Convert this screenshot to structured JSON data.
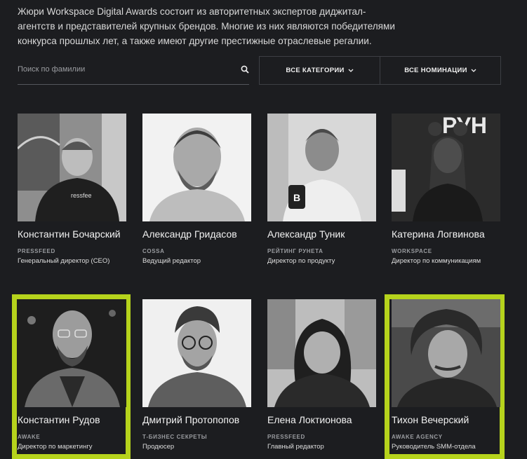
{
  "intro": "Жюри Workspace Digital Awards состоит из авторитетных экспертов диджитал-агентств и представителей крупных брендов. Многие из них являются победителями конкурса прошлых лет, а также имеют другие престижные отраслевые регалии.",
  "search": {
    "placeholder": "Поиск по фамилии",
    "icon": "search-icon"
  },
  "filters": {
    "categories_label": "Все категории",
    "nominations_label": "Все номинации",
    "icon": "chevron-down-icon"
  },
  "colors": {
    "background": "#1c1d20",
    "highlight": "#b6d31c"
  },
  "jury": [
    {
      "name": "Константин Бочарский",
      "company": "PRESSFEED",
      "role": "Генеральный директор (CEO)",
      "highlighted": false
    },
    {
      "name": "Александр Гридасов",
      "company": "COSSA",
      "role": "Ведущий редактор",
      "highlighted": false
    },
    {
      "name": "Александр Туник",
      "company": "РЕЙТИНГ РУНЕТА",
      "role": "Директор по продукту",
      "highlighted": false
    },
    {
      "name": "Катерина Логвинова",
      "company": "WORKSPACE",
      "role": "Директор по коммуникациям",
      "highlighted": false
    },
    {
      "name": "Константин Рудов",
      "company": "AWAKE",
      "role": "Директор по маркетингу",
      "highlighted": true
    },
    {
      "name": "Дмитрий Протопопов",
      "company": "Т-БИЗНЕС СЕКРЕТЫ",
      "role": "Продюсер",
      "highlighted": false
    },
    {
      "name": "Елена Локтионова",
      "company": "PRESSFEED",
      "role": "Главный редактор",
      "highlighted": false
    },
    {
      "name": "Тихон Вечерский",
      "company": "AWAKE AGENCY",
      "role": "Руководитель SMM-отдела",
      "highlighted": true
    }
  ]
}
